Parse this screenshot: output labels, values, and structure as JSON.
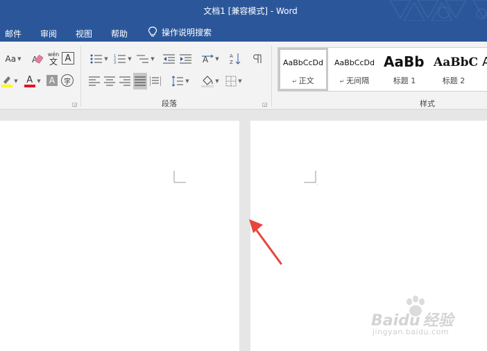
{
  "window": {
    "title": "文档1 [兼容模式]  -  Word"
  },
  "tabs": [
    {
      "label": "邮件"
    },
    {
      "label": "审阅"
    },
    {
      "label": "视图"
    },
    {
      "label": "帮助"
    }
  ],
  "tell_me": {
    "label": "操作说明搜索",
    "icon": "lightbulb-icon"
  },
  "ribbon": {
    "font_group": {
      "change_case_label": "Aa",
      "phonetic_guide_label": "wén",
      "phonetic_guide_char": "文",
      "border_char": "A",
      "font_color_char": "A",
      "shading_char": "A",
      "enclose_char": "字",
      "font_color": "#e81123",
      "highlight_color": "#ffff00"
    },
    "paragraph_group": {
      "label": "段落"
    },
    "styles_group": {
      "label": "样式",
      "items": [
        {
          "preview": "AaBbCcDd",
          "name": "正文",
          "selected": true
        },
        {
          "preview": "AaBbCcDd",
          "name": "无间隔"
        },
        {
          "preview": "AaBb",
          "name": "标题 1"
        },
        {
          "preview": "AaBbC",
          "name": "标题 2"
        }
      ],
      "partial_preview": "A"
    }
  },
  "watermark": {
    "brand": "Baidu",
    "brand_cn": "经验",
    "url": "jingyan.baidu.com"
  },
  "colors": {
    "title_bar": "#2b579a",
    "ribbon_bg": "#f3f3f3",
    "workspace_bg": "#e6e6e6",
    "annotation_arrow": "#e8453c"
  }
}
